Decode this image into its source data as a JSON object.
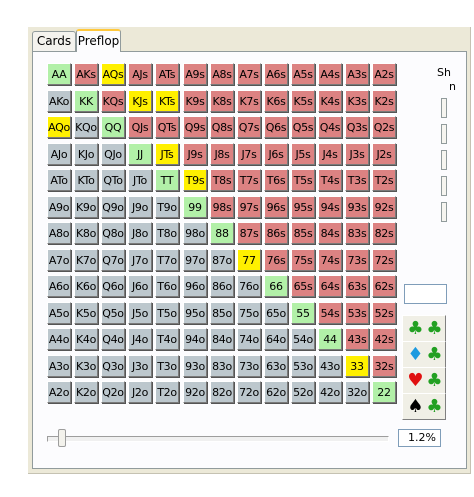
{
  "tabs": [
    {
      "label": "Cards",
      "active": false
    },
    {
      "label": "Preflop",
      "active": true
    }
  ],
  "right_label": {
    "line1": "Sh",
    "line2": "n"
  },
  "colors": {
    "pair": "#b2f0a8",
    "suited": "#dc8282",
    "offsuit": "#bcc7cd",
    "selected": "#fff000"
  },
  "grid": {
    "rows": [
      [
        {
          "t": "AA",
          "c": "pair",
          "s": false
        },
        {
          "t": "AKs",
          "c": "suited",
          "s": false
        },
        {
          "t": "AQs",
          "c": "suited",
          "s": true
        },
        {
          "t": "AJs",
          "c": "suited",
          "s": false
        },
        {
          "t": "ATs",
          "c": "suited",
          "s": false
        },
        {
          "t": "A9s",
          "c": "suited",
          "s": false
        },
        {
          "t": "A8s",
          "c": "suited",
          "s": false
        },
        {
          "t": "A7s",
          "c": "suited",
          "s": false
        },
        {
          "t": "A6s",
          "c": "suited",
          "s": false
        },
        {
          "t": "A5s",
          "c": "suited",
          "s": false
        },
        {
          "t": "A4s",
          "c": "suited",
          "s": false
        },
        {
          "t": "A3s",
          "c": "suited",
          "s": false
        },
        {
          "t": "A2s",
          "c": "suited",
          "s": false
        }
      ],
      [
        {
          "t": "AKo",
          "c": "offsuit",
          "s": false
        },
        {
          "t": "KK",
          "c": "pair",
          "s": false
        },
        {
          "t": "KQs",
          "c": "suited",
          "s": false
        },
        {
          "t": "KJs",
          "c": "suited",
          "s": true
        },
        {
          "t": "KTs",
          "c": "suited",
          "s": true
        },
        {
          "t": "K9s",
          "c": "suited",
          "s": false
        },
        {
          "t": "K8s",
          "c": "suited",
          "s": false
        },
        {
          "t": "K7s",
          "c": "suited",
          "s": false
        },
        {
          "t": "K6s",
          "c": "suited",
          "s": false
        },
        {
          "t": "K5s",
          "c": "suited",
          "s": false
        },
        {
          "t": "K4s",
          "c": "suited",
          "s": false
        },
        {
          "t": "K3s",
          "c": "suited",
          "s": false
        },
        {
          "t": "K2s",
          "c": "suited",
          "s": false
        }
      ],
      [
        {
          "t": "AQo",
          "c": "offsuit",
          "s": true
        },
        {
          "t": "KQo",
          "c": "offsuit",
          "s": false
        },
        {
          "t": "QQ",
          "c": "pair",
          "s": false
        },
        {
          "t": "QJs",
          "c": "suited",
          "s": false
        },
        {
          "t": "QTs",
          "c": "suited",
          "s": false
        },
        {
          "t": "Q9s",
          "c": "suited",
          "s": false
        },
        {
          "t": "Q8s",
          "c": "suited",
          "s": false
        },
        {
          "t": "Q7s",
          "c": "suited",
          "s": false
        },
        {
          "t": "Q6s",
          "c": "suited",
          "s": false
        },
        {
          "t": "Q5s",
          "c": "suited",
          "s": false
        },
        {
          "t": "Q4s",
          "c": "suited",
          "s": false
        },
        {
          "t": "Q3s",
          "c": "suited",
          "s": false
        },
        {
          "t": "Q2s",
          "c": "suited",
          "s": false
        }
      ],
      [
        {
          "t": "AJo",
          "c": "offsuit",
          "s": false
        },
        {
          "t": "KJo",
          "c": "offsuit",
          "s": false
        },
        {
          "t": "QJo",
          "c": "offsuit",
          "s": false
        },
        {
          "t": "JJ",
          "c": "pair",
          "s": false
        },
        {
          "t": "JTs",
          "c": "suited",
          "s": true
        },
        {
          "t": "J9s",
          "c": "suited",
          "s": false
        },
        {
          "t": "J8s",
          "c": "suited",
          "s": false
        },
        {
          "t": "J7s",
          "c": "suited",
          "s": false
        },
        {
          "t": "J6s",
          "c": "suited",
          "s": false
        },
        {
          "t": "J5s",
          "c": "suited",
          "s": false
        },
        {
          "t": "J4s",
          "c": "suited",
          "s": false
        },
        {
          "t": "J3s",
          "c": "suited",
          "s": false
        },
        {
          "t": "J2s",
          "c": "suited",
          "s": false
        }
      ],
      [
        {
          "t": "ATo",
          "c": "offsuit",
          "s": false
        },
        {
          "t": "KTo",
          "c": "offsuit",
          "s": false
        },
        {
          "t": "QTo",
          "c": "offsuit",
          "s": false
        },
        {
          "t": "JTo",
          "c": "offsuit",
          "s": false
        },
        {
          "t": "TT",
          "c": "pair",
          "s": false
        },
        {
          "t": "T9s",
          "c": "suited",
          "s": true
        },
        {
          "t": "T8s",
          "c": "suited",
          "s": false
        },
        {
          "t": "T7s",
          "c": "suited",
          "s": false
        },
        {
          "t": "T6s",
          "c": "suited",
          "s": false
        },
        {
          "t": "T5s",
          "c": "suited",
          "s": false
        },
        {
          "t": "T4s",
          "c": "suited",
          "s": false
        },
        {
          "t": "T3s",
          "c": "suited",
          "s": false
        },
        {
          "t": "T2s",
          "c": "suited",
          "s": false
        }
      ],
      [
        {
          "t": "A9o",
          "c": "offsuit",
          "s": false
        },
        {
          "t": "K9o",
          "c": "offsuit",
          "s": false
        },
        {
          "t": "Q9o",
          "c": "offsuit",
          "s": false
        },
        {
          "t": "J9o",
          "c": "offsuit",
          "s": false
        },
        {
          "t": "T9o",
          "c": "offsuit",
          "s": false
        },
        {
          "t": "99",
          "c": "pair",
          "s": false
        },
        {
          "t": "98s",
          "c": "suited",
          "s": false
        },
        {
          "t": "97s",
          "c": "suited",
          "s": false
        },
        {
          "t": "96s",
          "c": "suited",
          "s": false
        },
        {
          "t": "95s",
          "c": "suited",
          "s": false
        },
        {
          "t": "94s",
          "c": "suited",
          "s": false
        },
        {
          "t": "93s",
          "c": "suited",
          "s": false
        },
        {
          "t": "92s",
          "c": "suited",
          "s": false
        }
      ],
      [
        {
          "t": "A8o",
          "c": "offsuit",
          "s": false
        },
        {
          "t": "K8o",
          "c": "offsuit",
          "s": false
        },
        {
          "t": "Q8o",
          "c": "offsuit",
          "s": false
        },
        {
          "t": "J8o",
          "c": "offsuit",
          "s": false
        },
        {
          "t": "T8o",
          "c": "offsuit",
          "s": false
        },
        {
          "t": "98o",
          "c": "offsuit",
          "s": false
        },
        {
          "t": "88",
          "c": "pair",
          "s": false
        },
        {
          "t": "87s",
          "c": "suited",
          "s": false
        },
        {
          "t": "86s",
          "c": "suited",
          "s": false
        },
        {
          "t": "85s",
          "c": "suited",
          "s": false
        },
        {
          "t": "84s",
          "c": "suited",
          "s": false
        },
        {
          "t": "83s",
          "c": "suited",
          "s": false
        },
        {
          "t": "82s",
          "c": "suited",
          "s": false
        }
      ],
      [
        {
          "t": "A7o",
          "c": "offsuit",
          "s": false
        },
        {
          "t": "K7o",
          "c": "offsuit",
          "s": false
        },
        {
          "t": "Q7o",
          "c": "offsuit",
          "s": false
        },
        {
          "t": "J7o",
          "c": "offsuit",
          "s": false
        },
        {
          "t": "T7o",
          "c": "offsuit",
          "s": false
        },
        {
          "t": "97o",
          "c": "offsuit",
          "s": false
        },
        {
          "t": "87o",
          "c": "offsuit",
          "s": false
        },
        {
          "t": "77",
          "c": "pair",
          "s": true
        },
        {
          "t": "76s",
          "c": "suited",
          "s": false
        },
        {
          "t": "75s",
          "c": "suited",
          "s": false
        },
        {
          "t": "74s",
          "c": "suited",
          "s": false
        },
        {
          "t": "73s",
          "c": "suited",
          "s": false
        },
        {
          "t": "72s",
          "c": "suited",
          "s": false
        }
      ],
      [
        {
          "t": "A6o",
          "c": "offsuit",
          "s": false
        },
        {
          "t": "K6o",
          "c": "offsuit",
          "s": false
        },
        {
          "t": "Q6o",
          "c": "offsuit",
          "s": false
        },
        {
          "t": "J6o",
          "c": "offsuit",
          "s": false
        },
        {
          "t": "T6o",
          "c": "offsuit",
          "s": false
        },
        {
          "t": "96o",
          "c": "offsuit",
          "s": false
        },
        {
          "t": "86o",
          "c": "offsuit",
          "s": false
        },
        {
          "t": "76o",
          "c": "offsuit",
          "s": false
        },
        {
          "t": "66",
          "c": "pair",
          "s": false
        },
        {
          "t": "65s",
          "c": "suited",
          "s": false
        },
        {
          "t": "64s",
          "c": "suited",
          "s": false
        },
        {
          "t": "63s",
          "c": "suited",
          "s": false
        },
        {
          "t": "62s",
          "c": "suited",
          "s": false
        }
      ],
      [
        {
          "t": "A5o",
          "c": "offsuit",
          "s": false
        },
        {
          "t": "K5o",
          "c": "offsuit",
          "s": false
        },
        {
          "t": "Q5o",
          "c": "offsuit",
          "s": false
        },
        {
          "t": "J5o",
          "c": "offsuit",
          "s": false
        },
        {
          "t": "T5o",
          "c": "offsuit",
          "s": false
        },
        {
          "t": "95o",
          "c": "offsuit",
          "s": false
        },
        {
          "t": "85o",
          "c": "offsuit",
          "s": false
        },
        {
          "t": "75o",
          "c": "offsuit",
          "s": false
        },
        {
          "t": "65o",
          "c": "offsuit",
          "s": false
        },
        {
          "t": "55",
          "c": "pair",
          "s": false
        },
        {
          "t": "54s",
          "c": "suited",
          "s": false
        },
        {
          "t": "53s",
          "c": "suited",
          "s": false
        },
        {
          "t": "52s",
          "c": "suited",
          "s": false
        }
      ],
      [
        {
          "t": "A4o",
          "c": "offsuit",
          "s": false
        },
        {
          "t": "K4o",
          "c": "offsuit",
          "s": false
        },
        {
          "t": "Q4o",
          "c": "offsuit",
          "s": false
        },
        {
          "t": "J4o",
          "c": "offsuit",
          "s": false
        },
        {
          "t": "T4o",
          "c": "offsuit",
          "s": false
        },
        {
          "t": "94o",
          "c": "offsuit",
          "s": false
        },
        {
          "t": "84o",
          "c": "offsuit",
          "s": false
        },
        {
          "t": "74o",
          "c": "offsuit",
          "s": false
        },
        {
          "t": "64o",
          "c": "offsuit",
          "s": false
        },
        {
          "t": "54o",
          "c": "offsuit",
          "s": false
        },
        {
          "t": "44",
          "c": "pair",
          "s": false
        },
        {
          "t": "43s",
          "c": "suited",
          "s": false
        },
        {
          "t": "42s",
          "c": "suited",
          "s": false
        }
      ],
      [
        {
          "t": "A3o",
          "c": "offsuit",
          "s": false
        },
        {
          "t": "K3o",
          "c": "offsuit",
          "s": false
        },
        {
          "t": "Q3o",
          "c": "offsuit",
          "s": false
        },
        {
          "t": "J3o",
          "c": "offsuit",
          "s": false
        },
        {
          "t": "T3o",
          "c": "offsuit",
          "s": false
        },
        {
          "t": "93o",
          "c": "offsuit",
          "s": false
        },
        {
          "t": "83o",
          "c": "offsuit",
          "s": false
        },
        {
          "t": "73o",
          "c": "offsuit",
          "s": false
        },
        {
          "t": "63o",
          "c": "offsuit",
          "s": false
        },
        {
          "t": "53o",
          "c": "offsuit",
          "s": false
        },
        {
          "t": "43o",
          "c": "offsuit",
          "s": false
        },
        {
          "t": "33",
          "c": "pair",
          "s": true
        },
        {
          "t": "32s",
          "c": "suited",
          "s": false
        }
      ],
      [
        {
          "t": "A2o",
          "c": "offsuit",
          "s": false
        },
        {
          "t": "K2o",
          "c": "offsuit",
          "s": false
        },
        {
          "t": "Q2o",
          "c": "offsuit",
          "s": false
        },
        {
          "t": "J2o",
          "c": "offsuit",
          "s": false
        },
        {
          "t": "T2o",
          "c": "offsuit",
          "s": false
        },
        {
          "t": "92o",
          "c": "offsuit",
          "s": false
        },
        {
          "t": "82o",
          "c": "offsuit",
          "s": false
        },
        {
          "t": "72o",
          "c": "offsuit",
          "s": false
        },
        {
          "t": "62o",
          "c": "offsuit",
          "s": false
        },
        {
          "t": "52o",
          "c": "offsuit",
          "s": false
        },
        {
          "t": "42o",
          "c": "offsuit",
          "s": false
        },
        {
          "t": "32o",
          "c": "offsuit",
          "s": false
        },
        {
          "t": "22",
          "c": "pair",
          "s": false
        }
      ]
    ]
  },
  "suit_buttons": [
    {
      "name": "club-club-button",
      "left_glyph": "♣",
      "left_color": "#22a022",
      "left_icon": "club-icon",
      "right_glyph": "♣",
      "right_color": "#22a022",
      "right_icon": "club-icon"
    },
    {
      "name": "diamond-club-button",
      "left_glyph": "♦",
      "left_color": "#1c9ae0",
      "left_icon": "diamond-icon",
      "right_glyph": "♣",
      "right_color": "#22a022",
      "right_icon": "club-icon"
    },
    {
      "name": "heart-club-button",
      "left_glyph": "♥",
      "left_color": "#e01010",
      "left_icon": "heart-icon",
      "right_glyph": "♣",
      "right_color": "#22a022",
      "right_icon": "club-icon"
    },
    {
      "name": "spade-club-button",
      "left_glyph": "♠",
      "left_color": "#000000",
      "left_icon": "spade-icon",
      "right_glyph": "♣",
      "right_color": "#22a022",
      "right_icon": "club-icon"
    }
  ],
  "range_slider": {
    "value_fraction": 0.012
  },
  "range_percent": "1.2%"
}
